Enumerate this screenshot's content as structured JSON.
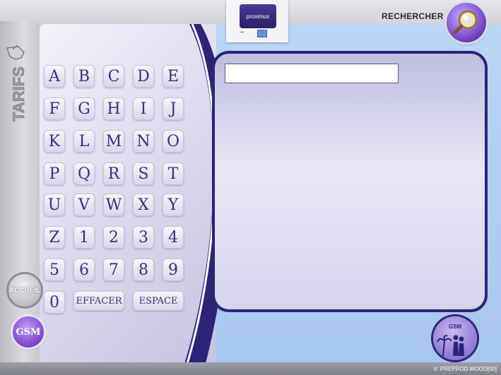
{
  "header": {
    "brand_logo_text": "proximus",
    "search_label": "RECHERCHER"
  },
  "sidebar": {
    "title": "TARIFS",
    "home_label": "ACCUEIL",
    "gsm_label": "GSM"
  },
  "keyboard": {
    "rows": [
      [
        "A",
        "B",
        "C",
        "D",
        "E"
      ],
      [
        "F",
        "G",
        "H",
        "I",
        "J"
      ],
      [
        "K",
        "L",
        "M",
        "N",
        "O"
      ],
      [
        "P",
        "Q",
        "R",
        "S",
        "T"
      ],
      [
        "U",
        "V",
        "W",
        "X",
        "Y"
      ],
      [
        "Z",
        "1",
        "2",
        "3",
        "4"
      ],
      [
        "5",
        "6",
        "7",
        "8",
        "9"
      ]
    ],
    "zero_key": "0",
    "delete_label": "EFFACER",
    "space_label": "ESPACE"
  },
  "results": {
    "search_value": ""
  },
  "corner": {
    "gsm_label": "GSM"
  },
  "footer": {
    "version": "V: PREPROD MOOD[00]"
  },
  "colors": {
    "accent": "#2d2478",
    "key_text": "#3a2e83",
    "panel_blue": "#a7c6ef",
    "purple_button": "#7a45cf"
  }
}
